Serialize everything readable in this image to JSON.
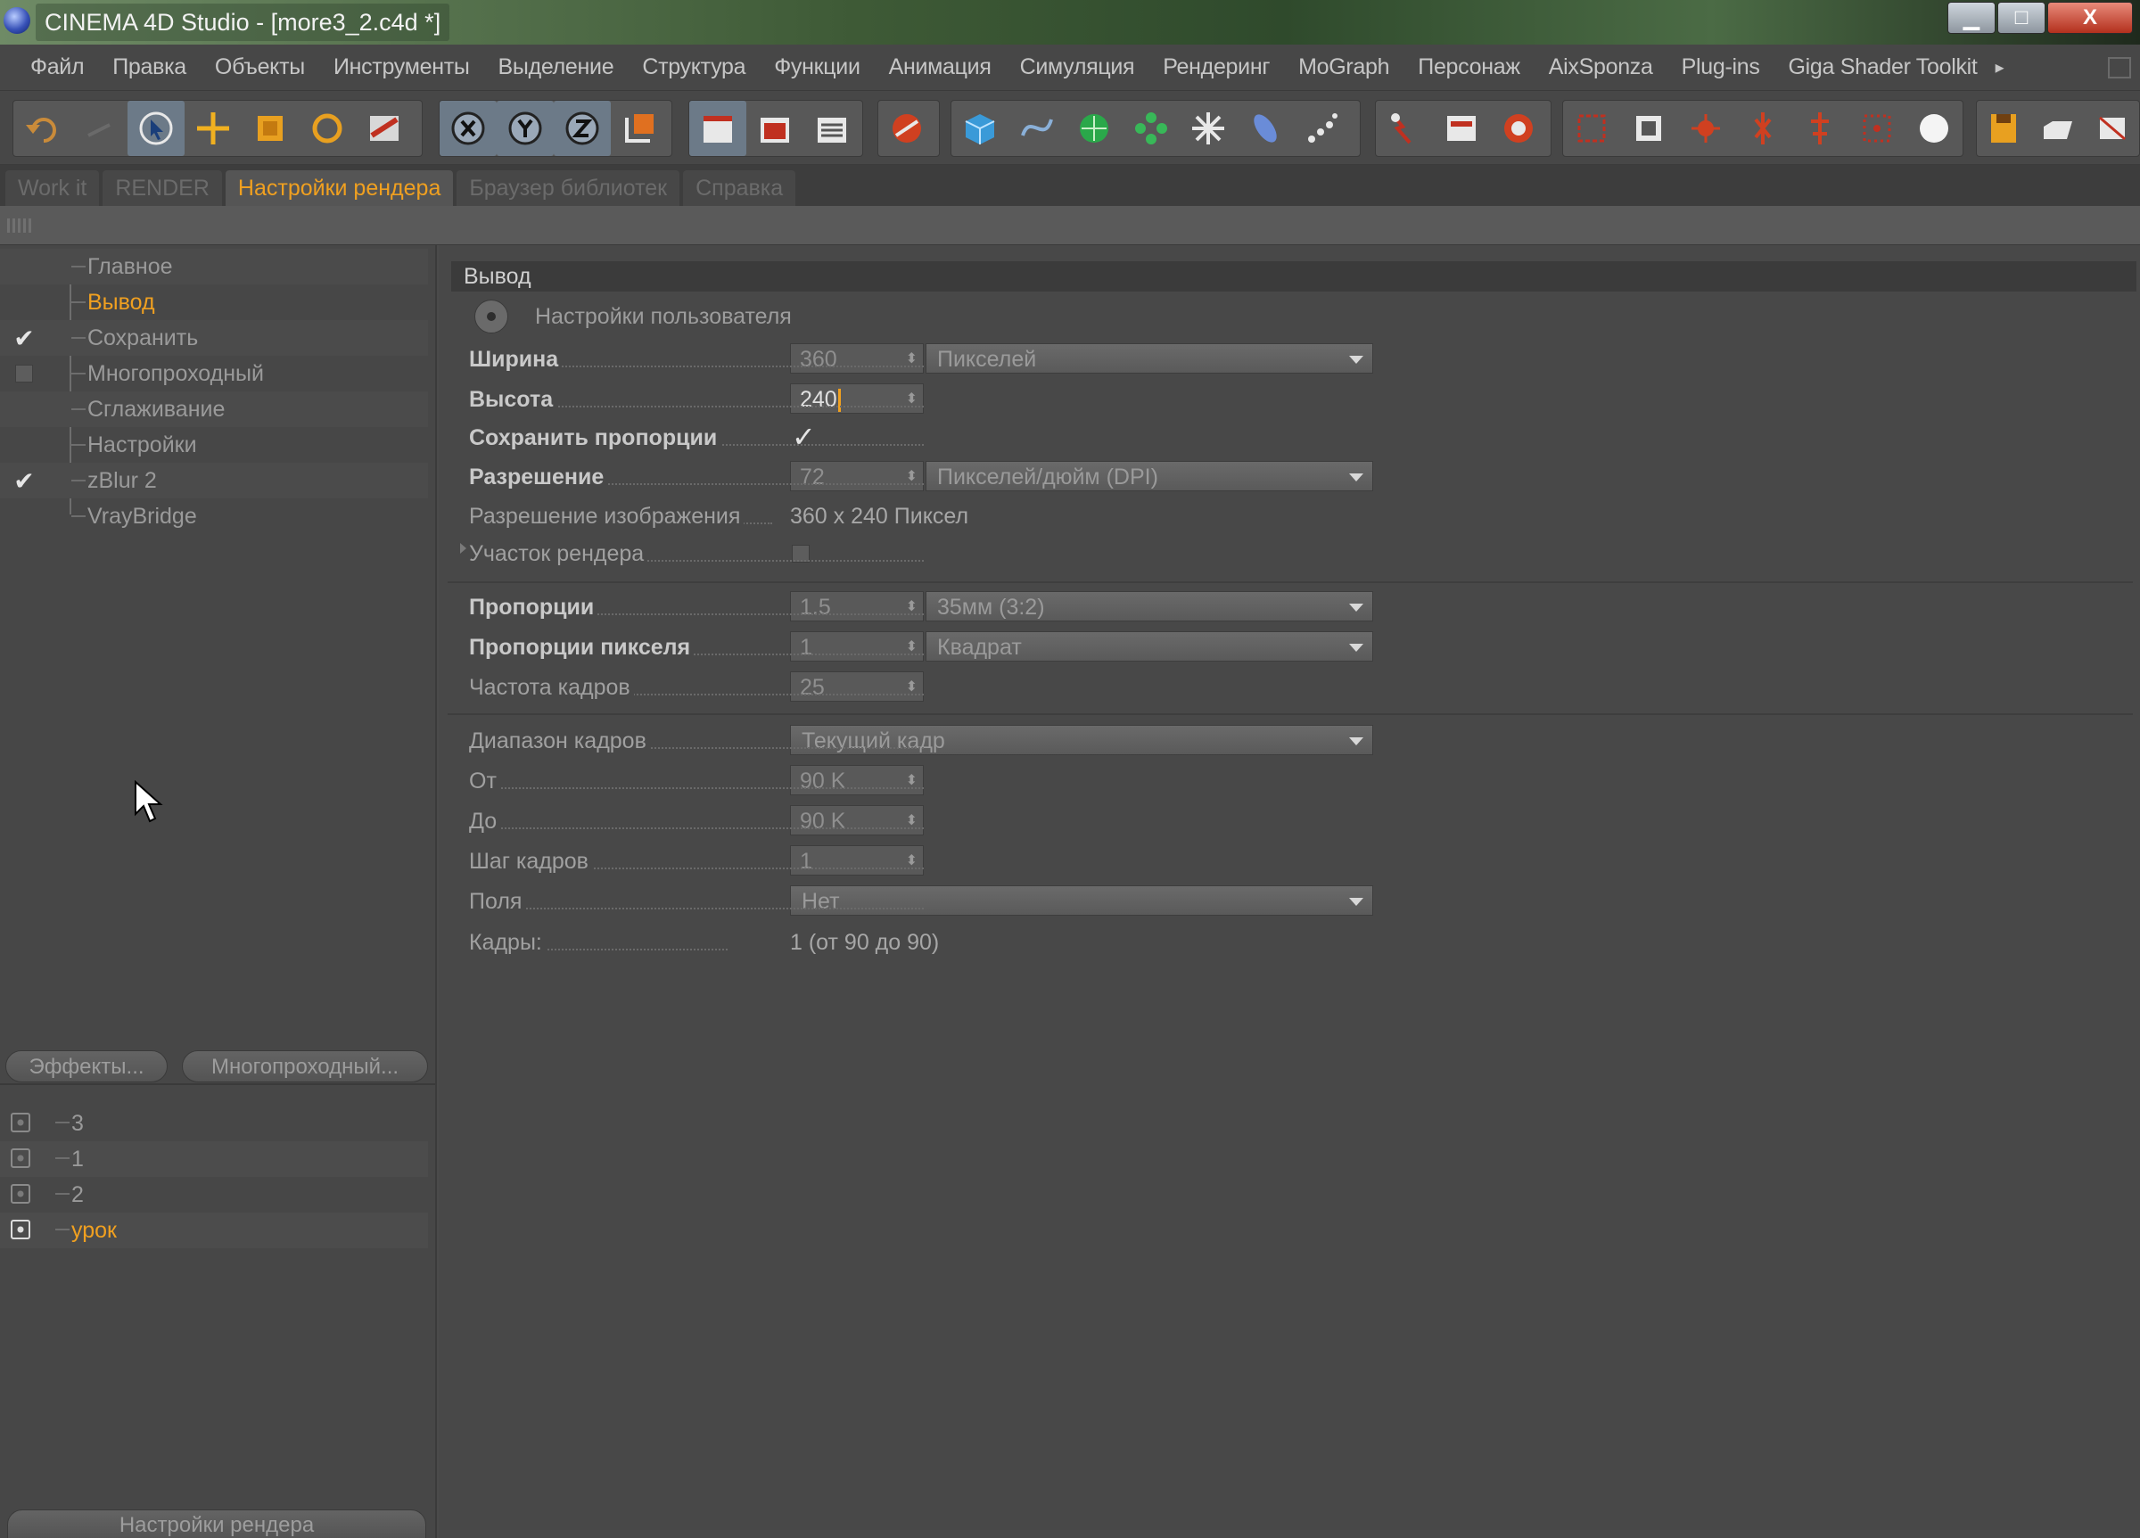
{
  "window": {
    "title": "CINEMA 4D Studio - [more3_2.c4d *]",
    "minimize": "▁",
    "maximize": "□",
    "close": "X"
  },
  "menu": [
    "Файл",
    "Правка",
    "Объекты",
    "Инструменты",
    "Выделение",
    "Структура",
    "Функции",
    "Анимация",
    "Симуляция",
    "Рендеринг",
    "MoGraph",
    "Персонаж",
    "AixSponza",
    "Plug-ins",
    "Giga Shader Toolkit"
  ],
  "layout_tabs": [
    {
      "label": "Work it",
      "active": false
    },
    {
      "label": "RENDER",
      "active": false
    },
    {
      "label": "Настройки рендера",
      "active": true
    },
    {
      "label": "Браузер библиотек",
      "active": false
    },
    {
      "label": "Справка",
      "active": false
    }
  ],
  "render_settings_tree": [
    {
      "label": "Главное",
      "checked": null,
      "selected": false
    },
    {
      "label": "Вывод",
      "checked": null,
      "selected": true
    },
    {
      "label": "Сохранить",
      "checked": true,
      "selected": false
    },
    {
      "label": "Многопроходный",
      "checked": false,
      "selected": false
    },
    {
      "label": "Сглаживание",
      "checked": null,
      "selected": false
    },
    {
      "label": "Настройки",
      "checked": null,
      "selected": false
    },
    {
      "label": "zBlur 2",
      "checked": true,
      "selected": false
    },
    {
      "label": "VrayBridge",
      "checked": null,
      "selected": false
    }
  ],
  "left_buttons": {
    "effects": "Эффекты...",
    "multipass": "Многопроходный..."
  },
  "render_setting_list": [
    {
      "label": "3",
      "active": false
    },
    {
      "label": "1",
      "active": false
    },
    {
      "label": "2",
      "active": false
    },
    {
      "label": "урок",
      "active": true
    }
  ],
  "bottom_button": "Настройки рендера",
  "output": {
    "section_title": "Вывод",
    "preset_label": "Настройки пользователя",
    "width": {
      "label": "Ширина",
      "value": "360",
      "unit": "Пикселей"
    },
    "height": {
      "label": "Высота",
      "value": "240"
    },
    "keep_ratio": {
      "label": "Сохранить пропорции",
      "checked": true
    },
    "resolution": {
      "label": "Разрешение",
      "value": "72",
      "unit": "Пикселей/дюйм (DPI)"
    },
    "image_resolution": {
      "label": "Разрешение изображения",
      "value": "360 x 240 Пиксел"
    },
    "render_region": {
      "label": "Участок рендера",
      "checked": false
    },
    "film_aspect": {
      "label": "Пропорции",
      "value": "1.5",
      "preset": "35мм (3:2)"
    },
    "pixel_aspect": {
      "label": "Пропорции пикселя",
      "value": "1",
      "preset": "Квадрат"
    },
    "frame_rate": {
      "label": "Частота кадров",
      "value": "25"
    },
    "frame_range": {
      "label": "Диапазон кадров",
      "value": "Текущий кадр"
    },
    "from": {
      "label": "От",
      "value": "90 K"
    },
    "to": {
      "label": "До",
      "value": "90 K"
    },
    "frame_step": {
      "label": "Шаг кадров",
      "value": "1"
    },
    "fields": {
      "label": "Поля",
      "value": "Нет"
    },
    "frames": {
      "label": "Кадры:",
      "value": "1 (от 90 до 90)"
    }
  }
}
